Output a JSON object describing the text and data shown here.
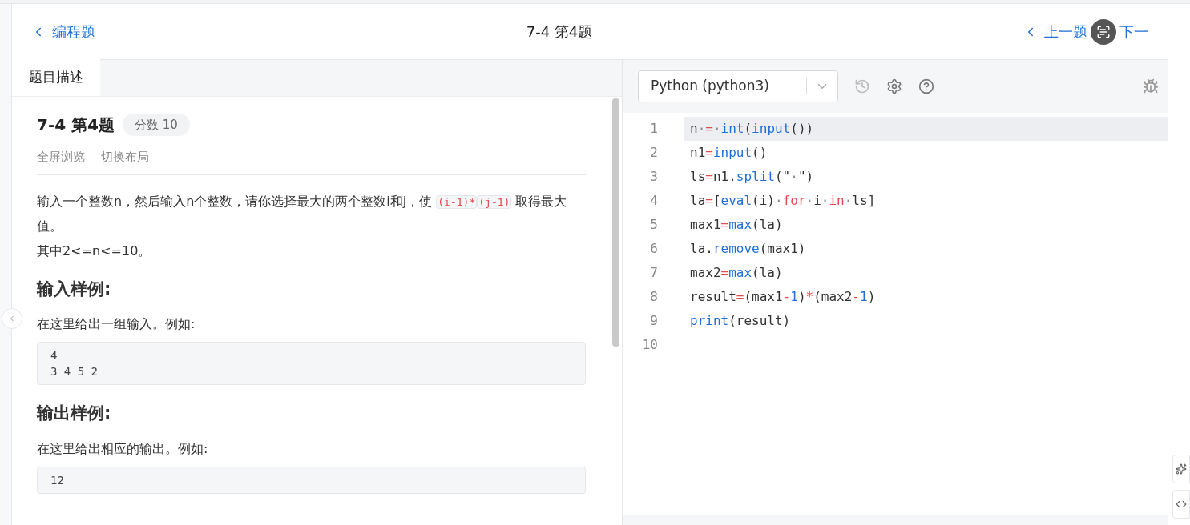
{
  "header": {
    "back_link": "编程题",
    "title": "7-4 第4题",
    "prev_link": "上一题",
    "next_link": "下一"
  },
  "tabs": [
    {
      "label": "题目描述",
      "selected": true
    }
  ],
  "problem": {
    "title": "7-4 第4题",
    "score_badge": "分数 10",
    "actions": [
      "全屏浏览",
      "切换布局"
    ],
    "statement": [
      {
        "kind": "text",
        "text": "输入一个整数n，然后输入n个整数，请你选择最大的两个整数i和j，使 "
      },
      {
        "kind": "code",
        "text": "(i-1)*"
      },
      {
        "kind": "code",
        "text": "(j-1)"
      },
      {
        "kind": "text",
        "text": " 取得最大值。"
      }
    ],
    "constraint": "其中2<=n<=10。",
    "sections": [
      {
        "heading": "输入样例:",
        "intro": "在这里给出一组输入。例如:",
        "sample": [
          "4",
          "3 4 5 2"
        ]
      },
      {
        "heading": "输出样例:",
        "intro": "在这里给出相应的输出。例如:",
        "sample": [
          "12"
        ]
      }
    ]
  },
  "editor": {
    "language": "Python (python3)",
    "line_numbers": [
      "1",
      "2",
      "3",
      "4",
      "5",
      "6",
      "7",
      "8",
      "9",
      "10"
    ],
    "lines": [
      {
        "selected": true,
        "tokens": [
          {
            "text": "n",
            "kind": "plain"
          },
          {
            "text": "·",
            "kind": "ws"
          },
          {
            "text": "=",
            "kind": "op"
          },
          {
            "text": "·",
            "kind": "ws"
          },
          {
            "text": "int",
            "kind": "func"
          },
          {
            "text": "(",
            "kind": "plain"
          },
          {
            "text": "input",
            "kind": "func"
          },
          {
            "text": "())",
            "kind": "plain"
          }
        ]
      },
      {
        "selected": false,
        "tokens": [
          {
            "text": "n1",
            "kind": "plain"
          },
          {
            "text": "=",
            "kind": "op"
          },
          {
            "text": "input",
            "kind": "func"
          },
          {
            "text": "()",
            "kind": "plain"
          }
        ]
      },
      {
        "selected": false,
        "tokens": [
          {
            "text": "ls",
            "kind": "plain"
          },
          {
            "text": "=",
            "kind": "op"
          },
          {
            "text": "n1.",
            "kind": "plain"
          },
          {
            "text": "split",
            "kind": "func"
          },
          {
            "text": "(\"",
            "kind": "plain"
          },
          {
            "text": "·",
            "kind": "ws"
          },
          {
            "text": "\")",
            "kind": "plain"
          }
        ]
      },
      {
        "selected": false,
        "tokens": [
          {
            "text": "la",
            "kind": "plain"
          },
          {
            "text": "=",
            "kind": "op"
          },
          {
            "text": "[",
            "kind": "plain"
          },
          {
            "text": "eval",
            "kind": "func"
          },
          {
            "text": "(i)",
            "kind": "plain"
          },
          {
            "text": "·",
            "kind": "ws"
          },
          {
            "text": "for",
            "kind": "kw"
          },
          {
            "text": "·",
            "kind": "ws"
          },
          {
            "text": "i",
            "kind": "plain"
          },
          {
            "text": "·",
            "kind": "ws"
          },
          {
            "text": "in",
            "kind": "kw"
          },
          {
            "text": "·",
            "kind": "ws"
          },
          {
            "text": "ls]",
            "kind": "plain"
          }
        ]
      },
      {
        "selected": false,
        "tokens": [
          {
            "text": "max1",
            "kind": "plain"
          },
          {
            "text": "=",
            "kind": "op"
          },
          {
            "text": "max",
            "kind": "func"
          },
          {
            "text": "(la)",
            "kind": "plain"
          }
        ]
      },
      {
        "selected": false,
        "tokens": [
          {
            "text": "la.",
            "kind": "plain"
          },
          {
            "text": "remove",
            "kind": "func"
          },
          {
            "text": "(max1)",
            "kind": "plain"
          }
        ]
      },
      {
        "selected": false,
        "tokens": [
          {
            "text": "max2",
            "kind": "plain"
          },
          {
            "text": "=",
            "kind": "op"
          },
          {
            "text": "max",
            "kind": "func"
          },
          {
            "text": "(la)",
            "kind": "plain"
          }
        ]
      },
      {
        "selected": false,
        "tokens": [
          {
            "text": "result",
            "kind": "plain"
          },
          {
            "text": "=",
            "kind": "op"
          },
          {
            "text": "(max1",
            "kind": "plain"
          },
          {
            "text": "-",
            "kind": "op"
          },
          {
            "text": "1",
            "kind": "num"
          },
          {
            "text": ")",
            "kind": "plain"
          },
          {
            "text": "*",
            "kind": "op"
          },
          {
            "text": "(max2",
            "kind": "plain"
          },
          {
            "text": "-",
            "kind": "op"
          },
          {
            "text": "1",
            "kind": "num"
          },
          {
            "text": ")",
            "kind": "plain"
          }
        ]
      },
      {
        "selected": false,
        "tokens": [
          {
            "text": "print",
            "kind": "func"
          },
          {
            "text": "(result)",
            "kind": "plain"
          }
        ]
      }
    ]
  }
}
